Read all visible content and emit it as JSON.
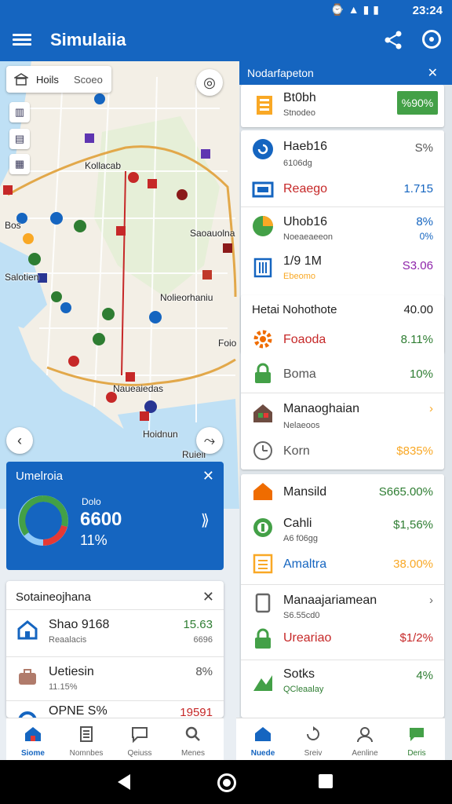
{
  "status_bar": {
    "time": "23:24"
  },
  "app_bar": {
    "title": "Simulaiia"
  },
  "map": {
    "search": {
      "label": "Hoils",
      "value": "Scoeo"
    },
    "labels": [
      "Kollacab",
      "Bos",
      "Saoauolna",
      "Salotien",
      "Nolieorhaniu",
      "Foio",
      "Naueaiedas",
      "Hoidnun",
      "Ruieii"
    ]
  },
  "blue_card": {
    "title": "Umelroia",
    "label": "Dolo",
    "value": "6600",
    "percent": "11%",
    "donut_colors": [
      "#43a047",
      "#e53935",
      "#90caf9"
    ]
  },
  "summary_card": {
    "title": "Sotaineojhana",
    "rows": [
      {
        "title": "Shao 9168",
        "sub": "Reaalacis",
        "value": "15.63",
        "value_sub": "6696",
        "value_color": "#2e7d32",
        "icon": "home-icon"
      },
      {
        "title": "Uetiesin",
        "sub": "11.15%",
        "value": "8%",
        "value_sub": "",
        "value_color": "#555555",
        "icon": "briefcase-icon"
      },
      {
        "title": "OPNE S%",
        "sub": "",
        "value": "19591",
        "value_sub": "",
        "value_color": "#c62828",
        "icon": "target-icon"
      }
    ]
  },
  "nav_left": [
    {
      "label": "Siome",
      "icon": "home-icon",
      "active": true
    },
    {
      "label": "Nomnbes",
      "icon": "document-icon",
      "active": false
    },
    {
      "label": "Qeiuss",
      "icon": "chat-icon",
      "active": false
    },
    {
      "label": "Menes",
      "icon": "search-icon",
      "active": false
    }
  ],
  "right_panel": {
    "header": "Nodarfapeton",
    "top_card": {
      "title": "Bt0bh",
      "sub": "Stnodeo",
      "pill": "%90%"
    },
    "card2": [
      {
        "title": "Haeb16",
        "sub": "6106dg",
        "value": "S%",
        "value_color": "#555555",
        "icon": "refresh-icon"
      },
      {
        "title": "Reaego",
        "sub": "",
        "value": "1.715",
        "value_color": "#1565c0",
        "icon": "monitor-icon",
        "title_color": "#c62828"
      },
      {
        "title": "Uhob16",
        "sub": "Noeaeaeeon",
        "value": "8%",
        "value2": "0%",
        "value_color": "#1565c0",
        "icon": "pie-icon"
      },
      {
        "title": "1/9 1M",
        "sub": "Ebeomo",
        "value": "S3.06",
        "value_color": "#8e24aa",
        "icon": "building-icon"
      }
    ],
    "card3": {
      "title": "Hetai Nohothote",
      "title_value": "40.00",
      "rows": [
        {
          "title": "Foaoda",
          "value": "8.11%",
          "value_color": "#2e7d32",
          "icon": "gear-icon",
          "title_color": "#c62828"
        },
        {
          "title": "Boma",
          "value": "10%",
          "value_color": "#2e7d32",
          "icon": "lock-icon"
        },
        {
          "title": "Manaoghaian",
          "sub": "Nelaeoos",
          "value": "›",
          "value_color": "#f9a825",
          "icon": "house-icon"
        },
        {
          "title": "Korn",
          "value": "$835%",
          "value_color": "#f9a825",
          "icon": "clock-icon"
        }
      ]
    },
    "card4": [
      {
        "title": "Mansild",
        "value": "S665.00%",
        "value_color": "#2e7d32",
        "icon": "home-icon"
      },
      {
        "title": "Cahli",
        "sub": "A6 f06gg",
        "value": "$1,56%",
        "value_color": "#2e7d32",
        "icon": "coin-icon"
      },
      {
        "title": "Amaltra",
        "value": "38.00%",
        "value_color": "#f9a825",
        "icon": "list-icon",
        "title_color": "#1565c0"
      },
      {
        "title": "Manaajariamean",
        "sub": "S6.55cd0",
        "value": "›",
        "value_color": "#666666",
        "icon": "phone-icon"
      },
      {
        "title": "Ureariao",
        "value": "$1/2%",
        "value_color": "#c62828",
        "icon": "lock-icon",
        "title_color": "#c62828"
      },
      {
        "title": "Sotks",
        "sub": "QCleaalay",
        "value": "4%",
        "value_color": "#2e7d32",
        "icon": "chart-icon"
      }
    ],
    "nav": [
      {
        "label": "Nuede",
        "icon": "home-icon",
        "active": true
      },
      {
        "label": "Sreiv",
        "icon": "refresh-icon",
        "active": false
      },
      {
        "label": "Aenline",
        "icon": "user-icon",
        "active": false
      },
      {
        "label": "Deris",
        "icon": "chat-icon",
        "active": false
      }
    ]
  }
}
